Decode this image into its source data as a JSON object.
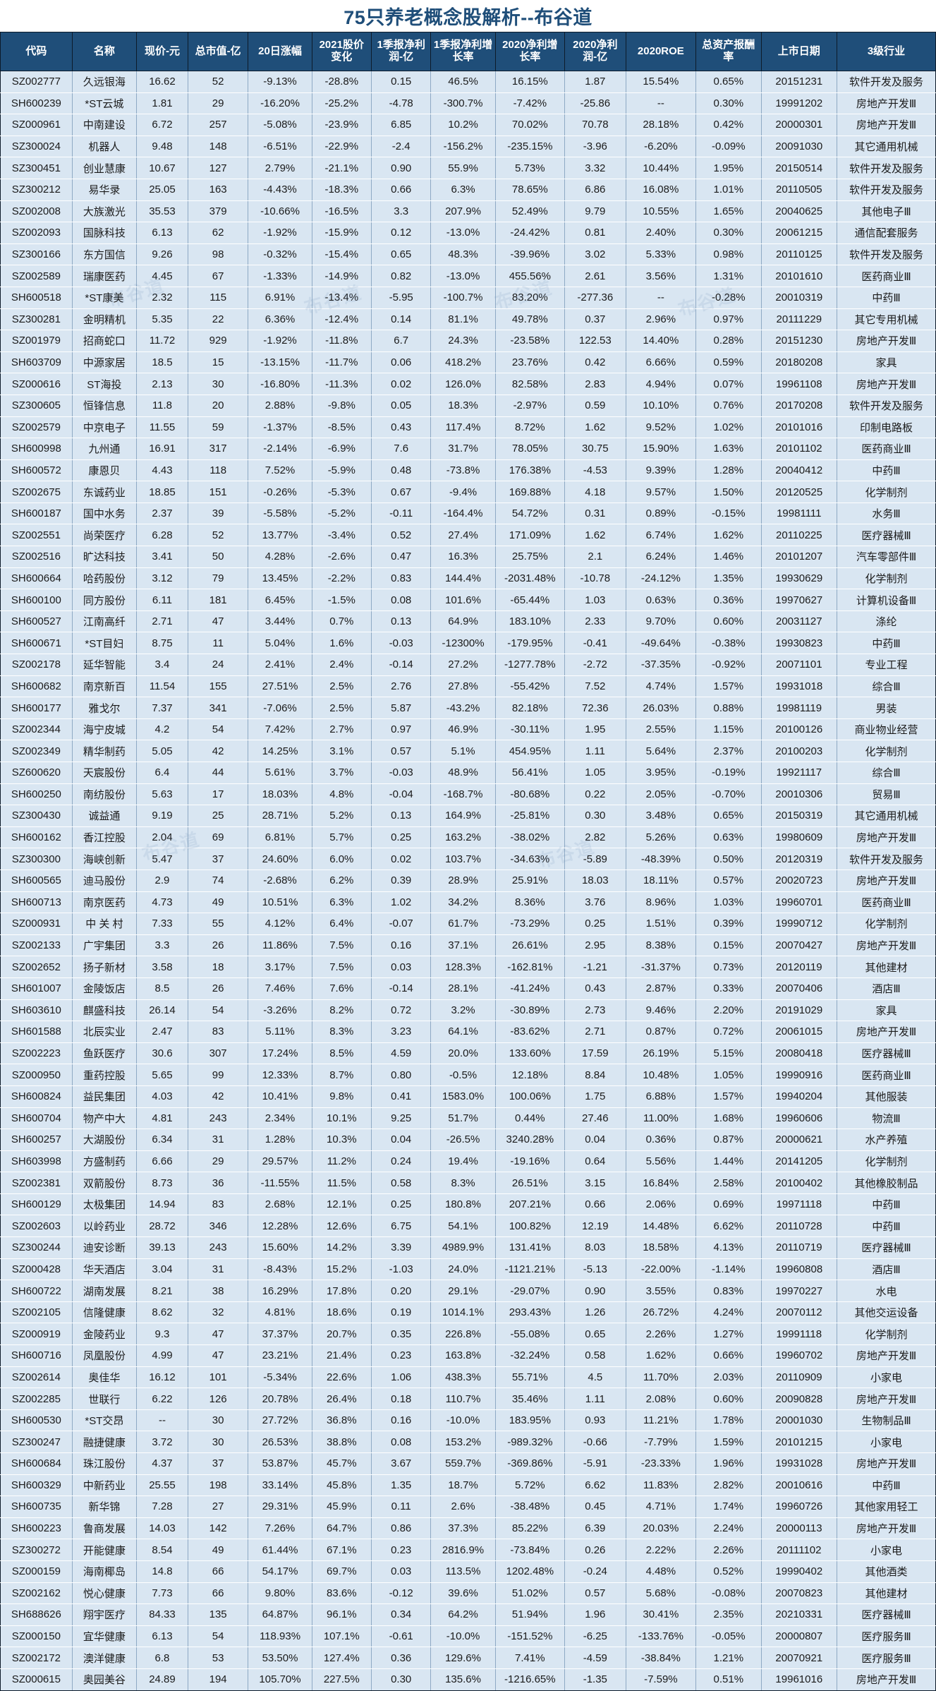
{
  "title": "75只养老概念股解析--布谷道",
  "watermark": "布谷道",
  "accent_color": "#1f4e79",
  "row_color": "#d9e6f2",
  "columns": [
    {
      "key": "code",
      "label": "代码"
    },
    {
      "key": "name",
      "label": "名称"
    },
    {
      "key": "price",
      "label": "现价-元"
    },
    {
      "key": "cap",
      "label": "总市值-亿"
    },
    {
      "key": "d20",
      "label": "20日涨幅"
    },
    {
      "key": "y2021",
      "label": "2021股价变化"
    },
    {
      "key": "q1p",
      "label": "1季报净利润-亿"
    },
    {
      "key": "q1g",
      "label": "1季报净利增长率"
    },
    {
      "key": "g2020",
      "label": "2020净利增长率"
    },
    {
      "key": "p2020",
      "label": "2020净利润-亿"
    },
    {
      "key": "roe",
      "label": "2020ROE"
    },
    {
      "key": "roa",
      "label": "总资产报酬率"
    },
    {
      "key": "date",
      "label": "上市日期"
    },
    {
      "key": "ind",
      "label": "3级行业"
    }
  ],
  "rows": [
    [
      "SZ002777",
      "久远银海",
      "16.62",
      "52",
      "-9.13%",
      "-28.8%",
      "0.15",
      "46.5%",
      "16.15%",
      "1.87",
      "15.54%",
      "0.65%",
      "20151231",
      "软件开发及服务"
    ],
    [
      "SH600239",
      "*ST云城",
      "1.81",
      "29",
      "-16.20%",
      "-25.2%",
      "-4.78",
      "-300.7%",
      "-7.42%",
      "-25.86",
      "--",
      "0.30%",
      "19991202",
      "房地产开发Ⅲ"
    ],
    [
      "SZ000961",
      "中南建设",
      "6.72",
      "257",
      "-5.08%",
      "-23.9%",
      "6.85",
      "10.2%",
      "70.02%",
      "70.78",
      "28.18%",
      "0.42%",
      "20000301",
      "房地产开发Ⅲ"
    ],
    [
      "SZ300024",
      "机器人",
      "9.48",
      "148",
      "-6.51%",
      "-22.9%",
      "-2.4",
      "-156.2%",
      "-235.15%",
      "-3.96",
      "-6.20%",
      "-0.09%",
      "20091030",
      "其它通用机械"
    ],
    [
      "SZ300451",
      "创业慧康",
      "10.67",
      "127",
      "2.79%",
      "-21.1%",
      "0.90",
      "55.9%",
      "5.73%",
      "3.32",
      "10.44%",
      "1.95%",
      "20150514",
      "软件开发及服务"
    ],
    [
      "SZ300212",
      "易华录",
      "25.05",
      "163",
      "-4.43%",
      "-18.3%",
      "0.66",
      "6.3%",
      "78.65%",
      "6.86",
      "16.08%",
      "1.01%",
      "20110505",
      "软件开发及服务"
    ],
    [
      "SZ002008",
      "大族激光",
      "35.53",
      "379",
      "-10.66%",
      "-16.5%",
      "3.3",
      "207.9%",
      "52.49%",
      "9.79",
      "10.55%",
      "1.65%",
      "20040625",
      "其他电子Ⅲ"
    ],
    [
      "SZ002093",
      "国脉科技",
      "6.13",
      "62",
      "-1.92%",
      "-15.9%",
      "0.12",
      "-13.0%",
      "-24.42%",
      "0.81",
      "2.40%",
      "0.30%",
      "20061215",
      "通信配套服务"
    ],
    [
      "SZ300166",
      "东方国信",
      "9.26",
      "98",
      "-0.32%",
      "-15.4%",
      "0.65",
      "48.3%",
      "-39.96%",
      "3.02",
      "5.33%",
      "0.98%",
      "20110125",
      "软件开发及服务"
    ],
    [
      "SZ002589",
      "瑞康医药",
      "4.45",
      "67",
      "-1.33%",
      "-14.9%",
      "0.82",
      "-13.0%",
      "455.56%",
      "2.61",
      "3.56%",
      "1.31%",
      "20101610",
      "医药商业Ⅲ"
    ],
    [
      "SH600518",
      "*ST康美",
      "2.32",
      "115",
      "6.91%",
      "-13.4%",
      "-5.95",
      "-100.7%",
      "83.20%",
      "-277.36",
      "--",
      "-0.28%",
      "20010319",
      "中药Ⅲ"
    ],
    [
      "SZ300281",
      "金明精机",
      "5.35",
      "22",
      "6.36%",
      "-12.4%",
      "0.14",
      "81.1%",
      "49.78%",
      "0.37",
      "2.96%",
      "0.97%",
      "20111229",
      "其它专用机械"
    ],
    [
      "SZ001979",
      "招商蛇口",
      "11.72",
      "929",
      "-1.92%",
      "-11.8%",
      "6.7",
      "24.3%",
      "-23.58%",
      "122.53",
      "14.40%",
      "0.28%",
      "20151230",
      "房地产开发Ⅲ"
    ],
    [
      "SH603709",
      "中源家居",
      "18.5",
      "15",
      "-13.15%",
      "-11.7%",
      "0.06",
      "418.2%",
      "23.76%",
      "0.42",
      "6.66%",
      "0.59%",
      "20180208",
      "家具"
    ],
    [
      "SZ000616",
      "ST海投",
      "2.13",
      "30",
      "-16.80%",
      "-11.3%",
      "0.02",
      "126.0%",
      "82.58%",
      "2.83",
      "4.94%",
      "0.07%",
      "19961108",
      "房地产开发Ⅲ"
    ],
    [
      "SZ300605",
      "恒锋信息",
      "11.8",
      "20",
      "2.88%",
      "-9.8%",
      "0.05",
      "18.3%",
      "-2.97%",
      "0.59",
      "10.10%",
      "0.76%",
      "20170208",
      "软件开发及服务"
    ],
    [
      "SZ002579",
      "中京电子",
      "11.55",
      "59",
      "-1.37%",
      "-8.5%",
      "0.43",
      "117.4%",
      "8.72%",
      "1.62",
      "9.52%",
      "1.02%",
      "20101016",
      "印制电路板"
    ],
    [
      "SH600998",
      "九州通",
      "16.91",
      "317",
      "-2.14%",
      "-6.9%",
      "7.6",
      "31.7%",
      "78.05%",
      "30.75",
      "15.90%",
      "1.63%",
      "20101102",
      "医药商业Ⅲ"
    ],
    [
      "SH600572",
      "康恩贝",
      "4.43",
      "118",
      "7.52%",
      "-5.9%",
      "0.48",
      "-73.8%",
      "176.38%",
      "-4.53",
      "9.39%",
      "1.28%",
      "20040412",
      "中药Ⅲ"
    ],
    [
      "SZ002675",
      "东诚药业",
      "18.85",
      "151",
      "-0.26%",
      "-5.3%",
      "0.67",
      "-9.4%",
      "169.88%",
      "4.18",
      "9.57%",
      "1.50%",
      "20120525",
      "化学制剂"
    ],
    [
      "SH600187",
      "国中水务",
      "2.37",
      "39",
      "-5.58%",
      "-5.2%",
      "-0.11",
      "-164.4%",
      "54.72%",
      "0.31",
      "0.89%",
      "-0.15%",
      "19981111",
      "水务Ⅲ"
    ],
    [
      "SZ002551",
      "尚荣医疗",
      "6.28",
      "52",
      "13.77%",
      "-3.4%",
      "0.52",
      "27.4%",
      "171.09%",
      "1.62",
      "6.74%",
      "1.62%",
      "20110225",
      "医疗器械Ⅲ"
    ],
    [
      "SZ002516",
      "旷达科技",
      "3.41",
      "50",
      "4.28%",
      "-2.6%",
      "0.47",
      "16.3%",
      "25.75%",
      "2.1",
      "6.24%",
      "1.46%",
      "20101207",
      "汽车零部件Ⅲ"
    ],
    [
      "SH600664",
      "哈药股份",
      "3.12",
      "79",
      "13.45%",
      "-2.2%",
      "0.83",
      "144.4%",
      "-2031.48%",
      "-10.78",
      "-24.12%",
      "1.35%",
      "19930629",
      "化学制剂"
    ],
    [
      "SH600100",
      "同方股份",
      "6.11",
      "181",
      "6.45%",
      "-1.5%",
      "0.08",
      "101.6%",
      "-65.44%",
      "1.03",
      "0.63%",
      "0.36%",
      "19970627",
      "计算机设备Ⅲ"
    ],
    [
      "SH600527",
      "江南高纤",
      "2.71",
      "47",
      "3.44%",
      "0.7%",
      "0.13",
      "64.9%",
      "183.10%",
      "2.33",
      "9.70%",
      "0.60%",
      "20031127",
      "涤纶"
    ],
    [
      "SH600671",
      "*ST目妇",
      "8.75",
      "11",
      "5.04%",
      "1.6%",
      "-0.03",
      "-12300%",
      "-179.95%",
      "-0.41",
      "-49.64%",
      "-0.38%",
      "19930823",
      "中药Ⅲ"
    ],
    [
      "SZ002178",
      "延华智能",
      "3.4",
      "24",
      "2.41%",
      "2.4%",
      "-0.14",
      "27.2%",
      "-1277.78%",
      "-2.72",
      "-37.35%",
      "-0.92%",
      "20071101",
      "专业工程"
    ],
    [
      "SH600682",
      "南京新百",
      "11.54",
      "155",
      "27.51%",
      "2.5%",
      "2.76",
      "27.8%",
      "-55.42%",
      "7.52",
      "4.74%",
      "1.57%",
      "19931018",
      "综合Ⅲ"
    ],
    [
      "SH600177",
      "雅戈尔",
      "7.37",
      "341",
      "-7.06%",
      "2.5%",
      "5.87",
      "-43.2%",
      "82.18%",
      "72.36",
      "26.03%",
      "0.88%",
      "19981119",
      "男装"
    ],
    [
      "SZ002344",
      "海宁皮城",
      "4.2",
      "54",
      "7.42%",
      "2.7%",
      "0.97",
      "46.9%",
      "-30.11%",
      "1.95",
      "2.55%",
      "1.15%",
      "20100126",
      "商业物业经营"
    ],
    [
      "SZ002349",
      "精华制药",
      "5.05",
      "42",
      "14.25%",
      "3.1%",
      "0.57",
      "5.1%",
      "454.95%",
      "1.11",
      "5.64%",
      "2.37%",
      "20100203",
      "化学制剂"
    ],
    [
      "SZ600620",
      "天宸股份",
      "6.4",
      "44",
      "5.61%",
      "3.7%",
      "-0.03",
      "48.9%",
      "56.41%",
      "1.05",
      "3.95%",
      "-0.19%",
      "19921117",
      "综合Ⅲ"
    ],
    [
      "SH600250",
      "南纺股份",
      "5.63",
      "17",
      "18.03%",
      "4.8%",
      "-0.04",
      "-168.7%",
      "-80.68%",
      "0.22",
      "2.05%",
      "-0.70%",
      "20010306",
      "贸易Ⅲ"
    ],
    [
      "SZ300430",
      "诚益通",
      "9.19",
      "25",
      "28.71%",
      "5.2%",
      "0.13",
      "164.9%",
      "-25.81%",
      "0.30",
      "3.48%",
      "0.65%",
      "20150319",
      "其它通用机械"
    ],
    [
      "SH600162",
      "香江控股",
      "2.04",
      "69",
      "6.81%",
      "5.7%",
      "0.25",
      "163.2%",
      "-38.02%",
      "2.82",
      "5.26%",
      "0.63%",
      "19980609",
      "房地产开发Ⅲ"
    ],
    [
      "SZ300300",
      "海峡创新",
      "5.47",
      "37",
      "24.60%",
      "6.0%",
      "0.02",
      "103.7%",
      "-34.63%",
      "-5.89",
      "-48.39%",
      "0.50%",
      "20120319",
      "软件开发及服务"
    ],
    [
      "SH600565",
      "迪马股份",
      "2.9",
      "74",
      "-2.68%",
      "6.2%",
      "0.39",
      "28.9%",
      "25.91%",
      "18.03",
      "18.11%",
      "0.57%",
      "20020723",
      "房地产开发Ⅲ"
    ],
    [
      "SH600713",
      "南京医药",
      "4.73",
      "49",
      "10.51%",
      "6.3%",
      "1.02",
      "34.2%",
      "8.36%",
      "3.76",
      "8.96%",
      "1.03%",
      "19960701",
      "医药商业Ⅲ"
    ],
    [
      "SZ000931",
      "中 关 村",
      "7.33",
      "55",
      "4.12%",
      "6.4%",
      "-0.07",
      "61.7%",
      "-73.29%",
      "0.25",
      "1.51%",
      "0.39%",
      "19990712",
      "化学制剂"
    ],
    [
      "SZ002133",
      "广宇集团",
      "3.3",
      "26",
      "11.86%",
      "7.5%",
      "0.16",
      "37.1%",
      "26.61%",
      "2.95",
      "8.38%",
      "0.15%",
      "20070427",
      "房地产开发Ⅲ"
    ],
    [
      "SZ002652",
      "扬子新材",
      "3.58",
      "18",
      "3.17%",
      "7.5%",
      "0.03",
      "128.3%",
      "-162.81%",
      "-1.21",
      "-31.37%",
      "0.73%",
      "20120119",
      "其他建材"
    ],
    [
      "SH601007",
      "金陵饭店",
      "8.5",
      "26",
      "7.46%",
      "7.6%",
      "-0.14",
      "28.1%",
      "-41.24%",
      "0.43",
      "2.87%",
      "0.33%",
      "20070406",
      "酒店Ⅲ"
    ],
    [
      "SH603610",
      "麒盛科技",
      "26.14",
      "54",
      "-3.26%",
      "8.2%",
      "0.72",
      "3.2%",
      "-30.89%",
      "2.73",
      "9.46%",
      "2.20%",
      "20191029",
      "家具"
    ],
    [
      "SH601588",
      "北辰实业",
      "2.47",
      "83",
      "5.11%",
      "8.3%",
      "3.23",
      "64.1%",
      "-83.62%",
      "2.71",
      "0.87%",
      "0.72%",
      "20061015",
      "房地产开发Ⅲ"
    ],
    [
      "SZ002223",
      "鱼跃医疗",
      "30.6",
      "307",
      "17.24%",
      "8.5%",
      "4.59",
      "20.0%",
      "133.60%",
      "17.59",
      "26.19%",
      "5.15%",
      "20080418",
      "医疗器械Ⅲ"
    ],
    [
      "SZ000950",
      "重药控股",
      "5.65",
      "99",
      "12.33%",
      "8.7%",
      "0.80",
      "-0.5%",
      "12.18%",
      "8.84",
      "10.48%",
      "1.05%",
      "19990916",
      "医药商业Ⅲ"
    ],
    [
      "SH600824",
      "益民集团",
      "4.03",
      "42",
      "10.41%",
      "9.8%",
      "0.41",
      "1583.0%",
      "100.06%",
      "1.75",
      "6.88%",
      "1.57%",
      "19940204",
      "其他服装"
    ],
    [
      "SH600704",
      "物产中大",
      "4.81",
      "243",
      "2.34%",
      "10.1%",
      "9.25",
      "51.7%",
      "0.44%",
      "27.46",
      "11.00%",
      "1.68%",
      "19960606",
      "物流Ⅲ"
    ],
    [
      "SH600257",
      "大湖股份",
      "6.34",
      "31",
      "1.28%",
      "10.3%",
      "0.04",
      "-26.5%",
      "3240.28%",
      "0.04",
      "0.36%",
      "0.87%",
      "20000621",
      "水产养殖"
    ],
    [
      "SH603998",
      "方盛制药",
      "6.66",
      "29",
      "29.57%",
      "11.2%",
      "0.24",
      "19.4%",
      "-19.16%",
      "0.64",
      "5.56%",
      "1.44%",
      "20141205",
      "化学制剂"
    ],
    [
      "SZ002381",
      "双箭股份",
      "8.73",
      "36",
      "-11.55%",
      "11.5%",
      "0.58",
      "8.3%",
      "26.51%",
      "3.15",
      "16.84%",
      "2.58%",
      "20100402",
      "其他橡胶制品"
    ],
    [
      "SH600129",
      "太极集团",
      "14.94",
      "83",
      "2.68%",
      "12.1%",
      "0.25",
      "180.8%",
      "207.21%",
      "0.66",
      "2.06%",
      "0.69%",
      "19971118",
      "中药Ⅲ"
    ],
    [
      "SZ002603",
      "以岭药业",
      "28.72",
      "346",
      "12.28%",
      "12.6%",
      "6.75",
      "54.1%",
      "100.82%",
      "12.19",
      "14.48%",
      "6.62%",
      "20110728",
      "中药Ⅲ"
    ],
    [
      "SZ300244",
      "迪安诊断",
      "39.13",
      "243",
      "15.60%",
      "14.2%",
      "3.39",
      "4989.9%",
      "131.41%",
      "8.03",
      "18.58%",
      "4.13%",
      "20110719",
      "医疗器械Ⅲ"
    ],
    [
      "SZ000428",
      "华天酒店",
      "3.04",
      "31",
      "-8.43%",
      "15.2%",
      "-1.03",
      "24.0%",
      "-1121.21%",
      "-5.13",
      "-22.00%",
      "-1.14%",
      "19960808",
      "酒店Ⅲ"
    ],
    [
      "SH600722",
      "湖南发展",
      "8.21",
      "38",
      "16.29%",
      "17.8%",
      "0.20",
      "29.1%",
      "-29.07%",
      "0.90",
      "3.55%",
      "0.83%",
      "19970227",
      "水电"
    ],
    [
      "SZ002105",
      "信隆健康",
      "8.62",
      "32",
      "4.81%",
      "18.6%",
      "0.19",
      "1014.1%",
      "293.43%",
      "1.26",
      "26.72%",
      "4.24%",
      "20070112",
      "其他交运设备"
    ],
    [
      "SZ000919",
      "金陵药业",
      "9.3",
      "47",
      "37.37%",
      "20.7%",
      "0.35",
      "226.8%",
      "-55.08%",
      "0.65",
      "2.26%",
      "1.27%",
      "19991118",
      "化学制剂"
    ],
    [
      "SH600716",
      "凤凰股份",
      "4.99",
      "47",
      "23.21%",
      "21.4%",
      "0.23",
      "163.8%",
      "-32.24%",
      "0.58",
      "1.62%",
      "0.66%",
      "19960702",
      "房地产开发Ⅲ"
    ],
    [
      "SZ002614",
      "奥佳华",
      "16.12",
      "101",
      "-5.34%",
      "22.6%",
      "1.06",
      "438.3%",
      "55.71%",
      "4.5",
      "11.70%",
      "2.03%",
      "20110909",
      "小家电"
    ],
    [
      "SZ002285",
      "世联行",
      "6.22",
      "126",
      "20.78%",
      "26.4%",
      "0.18",
      "110.7%",
      "35.46%",
      "1.11",
      "2.08%",
      "0.60%",
      "20090828",
      "房地产开发Ⅲ"
    ],
    [
      "SH600530",
      "*ST交昂",
      "--",
      "30",
      "27.72%",
      "36.8%",
      "0.16",
      "-10.0%",
      "183.95%",
      "0.93",
      "11.21%",
      "1.78%",
      "20001030",
      "生物制品Ⅲ"
    ],
    [
      "SZ300247",
      "融捷健康",
      "3.72",
      "30",
      "26.53%",
      "38.8%",
      "0.08",
      "153.2%",
      "-989.32%",
      "-0.66",
      "-7.79%",
      "1.59%",
      "20101215",
      "小家电"
    ],
    [
      "SH600684",
      "珠江股份",
      "4.37",
      "37",
      "53.87%",
      "45.7%",
      "3.67",
      "559.7%",
      "-369.86%",
      "-5.91",
      "-23.33%",
      "1.96%",
      "19931028",
      "房地产开发Ⅲ"
    ],
    [
      "SH600329",
      "中新药业",
      "25.55",
      "198",
      "33.14%",
      "45.8%",
      "1.35",
      "18.7%",
      "5.72%",
      "6.62",
      "11.83%",
      "2.82%",
      "20010616",
      "中药Ⅲ"
    ],
    [
      "SH600735",
      "新华锦",
      "7.28",
      "27",
      "29.31%",
      "45.9%",
      "0.11",
      "2.6%",
      "-38.48%",
      "0.45",
      "4.71%",
      "1.74%",
      "19960726",
      "其他家用轻工"
    ],
    [
      "SH600223",
      "鲁商发展",
      "14.03",
      "142",
      "7.26%",
      "64.7%",
      "0.86",
      "37.3%",
      "85.22%",
      "6.39",
      "20.03%",
      "2.24%",
      "20000113",
      "房地产开发Ⅲ"
    ],
    [
      "SZ300272",
      "开能健康",
      "8.54",
      "49",
      "61.44%",
      "67.1%",
      "0.23",
      "2816.9%",
      "-73.84%",
      "0.26",
      "2.22%",
      "2.26%",
      "20111102",
      "小家电"
    ],
    [
      "SZ000159",
      "海南椰岛",
      "14.8",
      "66",
      "54.17%",
      "69.7%",
      "0.03",
      "113.5%",
      "1202.48%",
      "-0.24",
      "4.48%",
      "0.52%",
      "19990402",
      "其他酒类"
    ],
    [
      "SZ002162",
      "悦心健康",
      "7.73",
      "66",
      "9.80%",
      "83.6%",
      "-0.12",
      "39.6%",
      "51.02%",
      "0.57",
      "5.68%",
      "-0.08%",
      "20070823",
      "其他建材"
    ],
    [
      "SH688626",
      "翔宇医疗",
      "84.33",
      "135",
      "64.87%",
      "96.1%",
      "0.34",
      "64.2%",
      "51.94%",
      "1.96",
      "30.41%",
      "2.35%",
      "20210331",
      "医疗器械Ⅲ"
    ],
    [
      "SZ000150",
      "宜华健康",
      "6.13",
      "54",
      "118.93%",
      "107.1%",
      "-0.61",
      "-10.0%",
      "-151.52%",
      "-6.25",
      "-133.76%",
      "-0.05%",
      "20000807",
      "医疗服务Ⅲ"
    ],
    [
      "SZ002172",
      "澳洋健康",
      "6.8",
      "53",
      "53.50%",
      "127.4%",
      "0.36",
      "129.6%",
      "7.41%",
      "-4.59",
      "-38.84%",
      "1.21%",
      "20070921",
      "医疗服务Ⅲ"
    ],
    [
      "SZ000615",
      "奥园美谷",
      "24.89",
      "194",
      "105.70%",
      "227.5%",
      "0.30",
      "135.6%",
      "-1216.65%",
      "-1.35",
      "-7.59%",
      "0.51%",
      "19961016",
      "房地产开发Ⅲ"
    ]
  ]
}
